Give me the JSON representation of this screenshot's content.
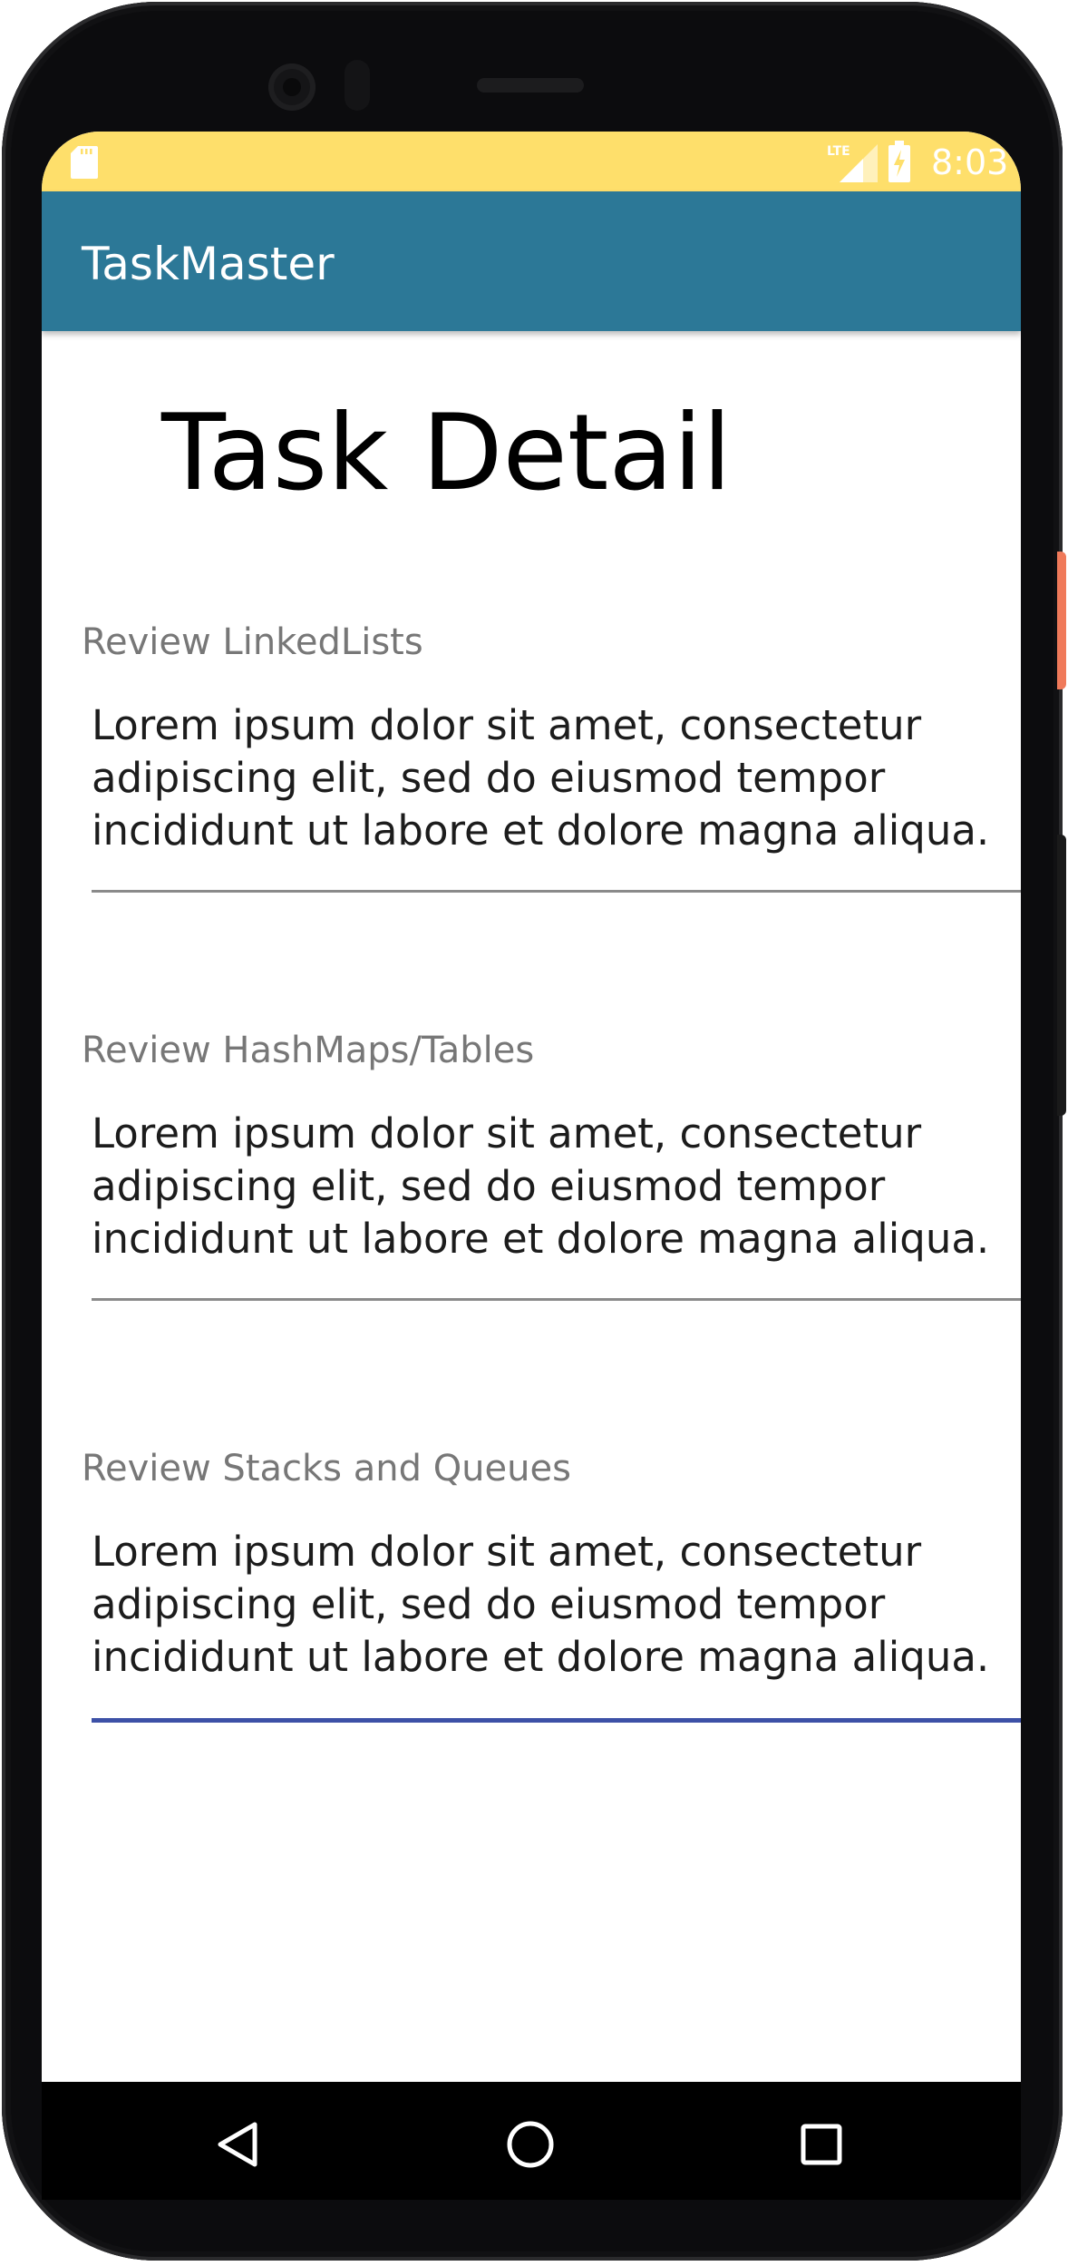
{
  "status_bar": {
    "time": "8:03",
    "sd_icon": "sd-card-icon",
    "network_icon": "lte-signal-icon",
    "battery_icon": "battery-charging-icon",
    "background_color": "#fedf6b"
  },
  "app_bar": {
    "title": "TaskMaster",
    "background_color": "#2c7897"
  },
  "page": {
    "title": "Task Detail"
  },
  "tasks": [
    {
      "label": "Review LinkedLists",
      "body": "Lorem ipsum dolor sit amet, consectetur\nadipiscing elit, sed do eiusmod tempor\nincididunt ut labore et dolore magna aliqua."
    },
    {
      "label": "Review HashMaps/Tables",
      "body": "Lorem ipsum dolor sit amet, consectetur\nadipiscing elit, sed do eiusmod tempor\nincididunt ut labore et dolore magna aliqua."
    },
    {
      "label": "Review Stacks and Queues",
      "body": "Lorem ipsum dolor sit amet, consectetur\nadipiscing elit, sed do eiusmod tempor\nincididunt ut labore et dolore magna aliqua.",
      "focused": true
    }
  ],
  "nav_bar": {
    "back_icon": "back-triangle-icon",
    "home_icon": "home-circle-icon",
    "recents_icon": "recents-square-icon"
  },
  "colors": {
    "focus_underline": "#3d51a7",
    "underline": "#8a8a8a",
    "label_text": "#777777"
  }
}
